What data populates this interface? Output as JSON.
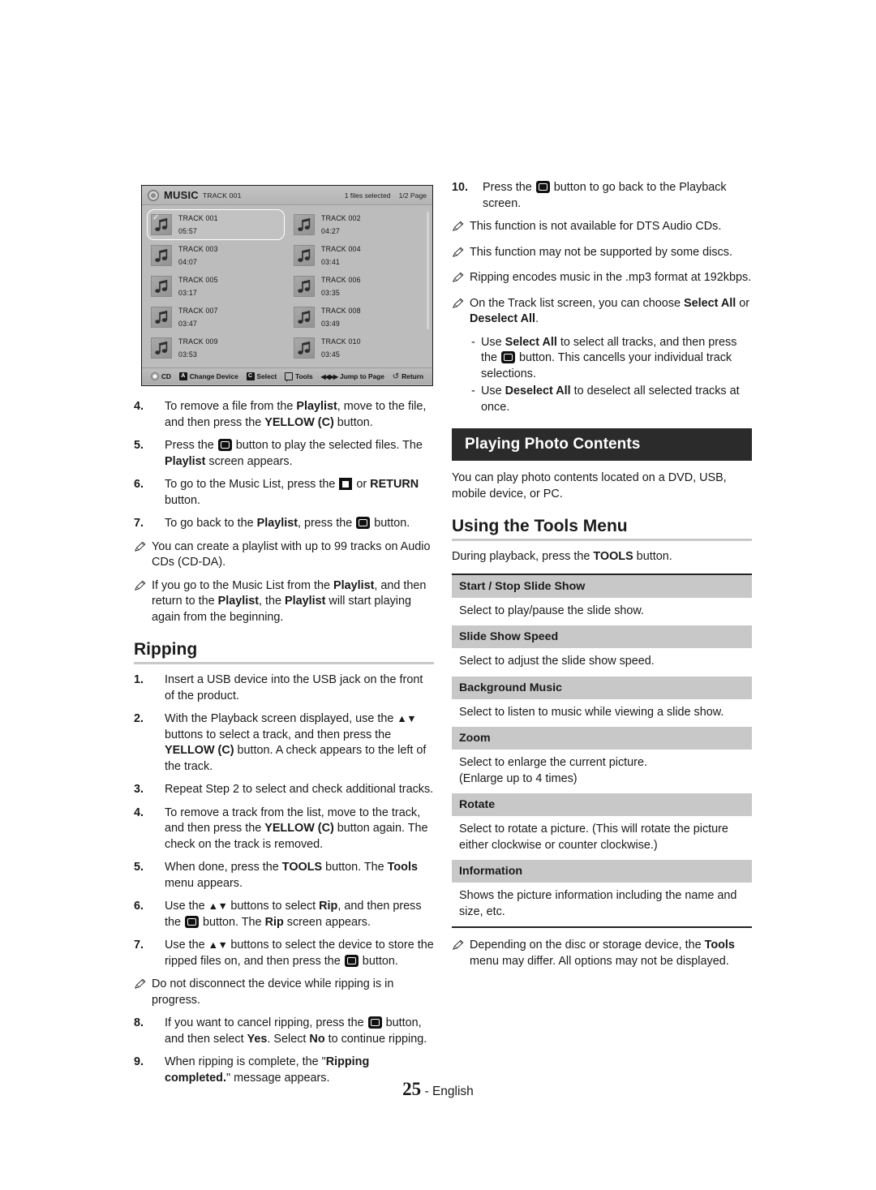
{
  "tv_screenshot": {
    "header": {
      "disc_icon": "disc-icon",
      "title": "MUSIC",
      "subtitle": "TRACK 001",
      "files_selected": "1 files selected",
      "page_indicator": "1/2 Page"
    },
    "tracks": [
      {
        "name": "TRACK 001",
        "time": "05:57",
        "selected": true,
        "checked": true
      },
      {
        "name": "TRACK 002",
        "time": "04:27",
        "selected": false,
        "checked": false
      },
      {
        "name": "TRACK 003",
        "time": "04:07",
        "selected": false,
        "checked": false
      },
      {
        "name": "TRACK 004",
        "time": "03:41",
        "selected": false,
        "checked": false
      },
      {
        "name": "TRACK 005",
        "time": "03:17",
        "selected": false,
        "checked": false
      },
      {
        "name": "TRACK 006",
        "time": "03:35",
        "selected": false,
        "checked": false
      },
      {
        "name": "TRACK 007",
        "time": "03:47",
        "selected": false,
        "checked": false
      },
      {
        "name": "TRACK 008",
        "time": "03:49",
        "selected": false,
        "checked": false
      },
      {
        "name": "TRACK 009",
        "time": "03:53",
        "selected": false,
        "checked": false
      },
      {
        "name": "TRACK 010",
        "time": "03:45",
        "selected": false,
        "checked": false
      }
    ],
    "footer_items": [
      {
        "icon": "disc-icon",
        "label": "CD"
      },
      {
        "icon": "a-button-icon",
        "label": "Change Device"
      },
      {
        "icon": "c-button-icon",
        "label": "Select"
      },
      {
        "icon": "tools-icon",
        "label": "Tools"
      },
      {
        "icon": "skip-icon",
        "label": "Jump to Page"
      },
      {
        "icon": "return-icon",
        "label": "Return"
      }
    ]
  },
  "left_column": {
    "steps_playlist": [
      {
        "num": "4.",
        "text": "To remove a file from the Playlist, move to the file, and then press the YELLOW (C) button."
      },
      {
        "num": "5.",
        "text": "Press the [ENTER] button to play the selected files. The Playlist screen appears."
      },
      {
        "num": "6.",
        "text": "To go to the Music List, press the [STOP] or RETURN button."
      },
      {
        "num": "7.",
        "text": "To go back to the Playlist, press the [ENTER] button."
      }
    ],
    "notes_playlist": [
      {
        "text": "You can create a playlist with up to 99 tracks on Audio CDs (CD-DA)."
      },
      {
        "text": "If you go to the Music List from the Playlist, and then return to the Playlist, the Playlist will start playing again from the beginning."
      }
    ],
    "ripping_heading": "Ripping",
    "steps_ripping": [
      {
        "num": "1.",
        "text": "Insert a USB device into the USB jack on the front of the product."
      },
      {
        "num": "2.",
        "text": "With the Playback screen displayed, use the ▲▼ buttons to select a track, and then press the YELLOW (C) button. A check appears to the left of the track."
      },
      {
        "num": "3.",
        "text": "Repeat Step 2 to select and check additional tracks."
      },
      {
        "num": "4.",
        "text": "To remove a track from the list, move to the track, and then press the YELLOW (C) button again. The check on the track is removed."
      },
      {
        "num": "5.",
        "text": "When done, press the TOOLS button. The Tools menu appears."
      },
      {
        "num": "6.",
        "text": "Use the ▲▼ buttons to select Rip, and then press the [ENTER] button. The Rip screen appears."
      },
      {
        "num": "7.",
        "text": "Use the ▲▼ buttons to select the device to store the ripped files on, and then press the [ENTER] button."
      }
    ],
    "note_ripping": "Do not disconnect the device while ripping is in progress.",
    "steps_ripping_tail": [
      {
        "num": "8.",
        "text": "If you want to cancel ripping, press the [ENTER] button, and then select Yes. Select No to continue ripping."
      },
      {
        "num": "9.",
        "text": "When ripping is complete, the \"Ripping completed.\" message appears."
      }
    ]
  },
  "right_column": {
    "step_10": {
      "num": "10.",
      "text": "Press the [ENTER] button to go back to the Playback screen."
    },
    "notes": [
      {
        "text": "This function is not available for DTS Audio CDs."
      },
      {
        "text": "This function may not be supported by some discs."
      },
      {
        "text": "Ripping encodes music in the .mp3 format at 192kbps."
      },
      {
        "text": "On the Track list screen, you can choose Select All or Deselect All."
      }
    ],
    "subnotes": [
      {
        "dash": "-",
        "text": "Use Select All to select all tracks, and then press the [ENTER] button. This cancells your individual track selections."
      },
      {
        "dash": "-",
        "text": "Use Deselect All to deselect all selected tracks at once."
      }
    ],
    "section_heading": "Playing Photo Contents",
    "section_intro": "You can play photo contents located on a DVD, USB, mobile device, or PC.",
    "tools_heading": "Using the Tools Menu",
    "tools_intro": "During playback, press the TOOLS button.",
    "tools_rows": [
      {
        "title": "Start / Stop Slide Show",
        "desc": "Select to play/pause the slide show."
      },
      {
        "title": "Slide Show Speed",
        "desc": "Select to adjust the slide show speed."
      },
      {
        "title": "Background Music",
        "desc": "Select to listen to music while viewing a slide show."
      },
      {
        "title": "Zoom",
        "desc": "Select to enlarge the current picture.\n(Enlarge up to 4 times)"
      },
      {
        "title": "Rotate",
        "desc": "Select to rotate a picture. (This will rotate the picture either clockwise or counter clockwise.)"
      },
      {
        "title": "Information",
        "desc": "Shows the picture information including the name and size, etc."
      }
    ],
    "final_note": "Depending on the disc or storage device, the Tools menu may differ. All options may not be displayed."
  },
  "footer": {
    "page_number": "25",
    "separator": "-",
    "language": "English"
  },
  "colors": {
    "heading_bar_bg": "#2b2b2b",
    "table_head_bg": "#c8c8c8",
    "rule": "#c9c9c9",
    "text": "#1a1a1a"
  }
}
